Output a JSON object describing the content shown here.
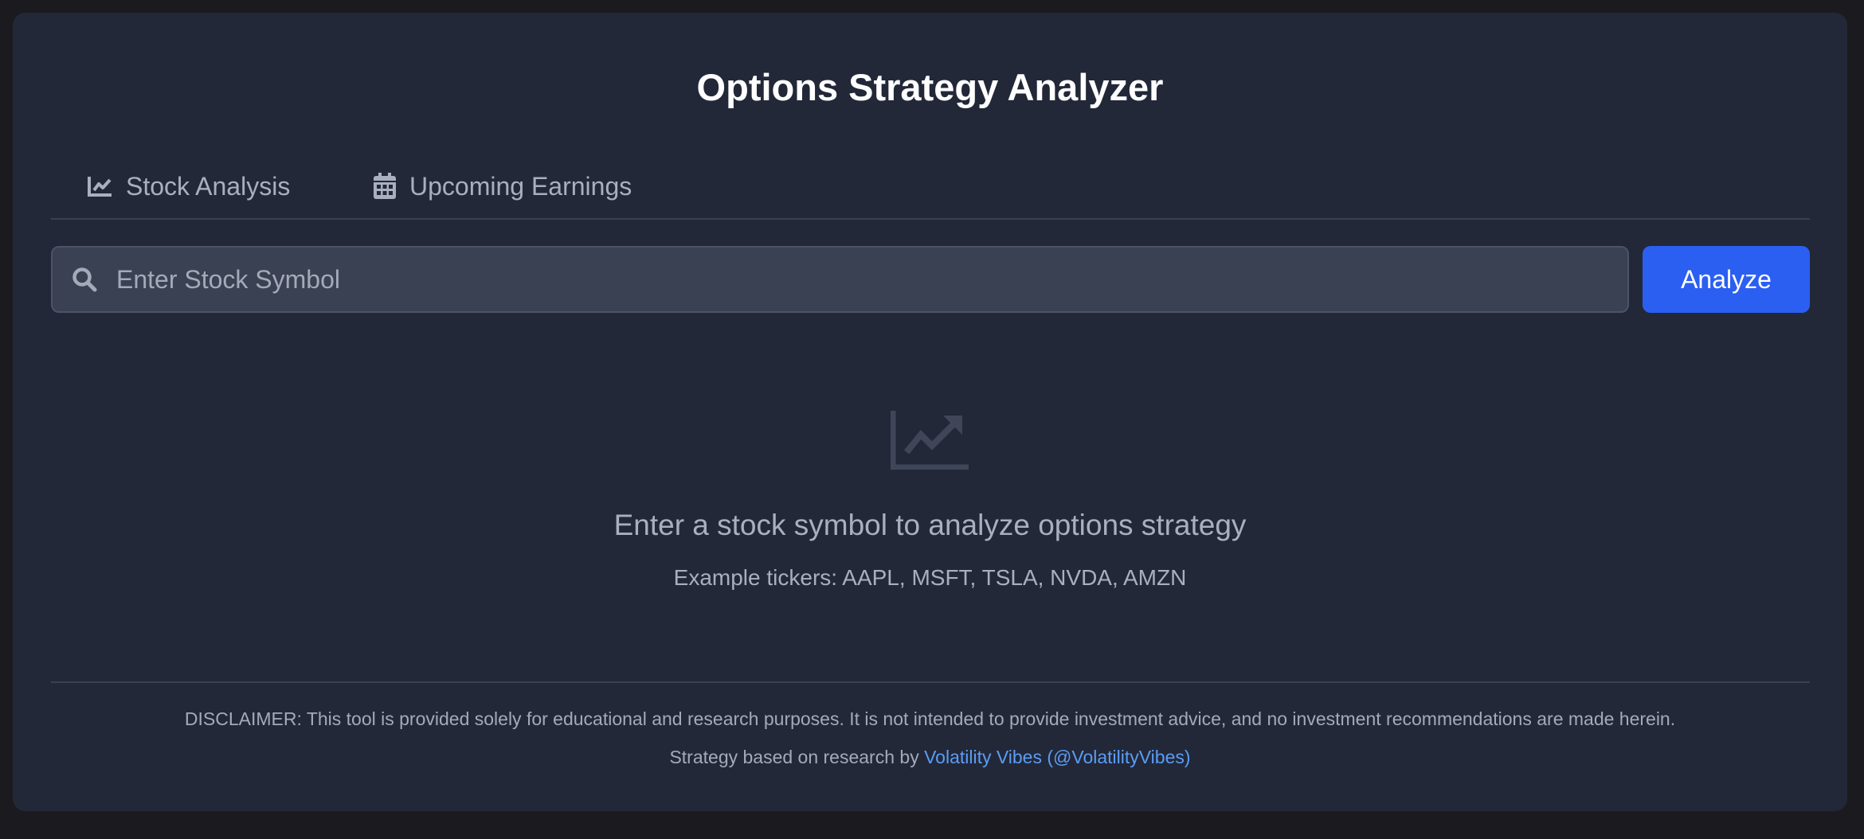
{
  "app": {
    "title": "Options Strategy Analyzer"
  },
  "tabs": [
    {
      "label": "Stock Analysis",
      "icon": "chart-line-icon",
      "active": true
    },
    {
      "label": "Upcoming Earnings",
      "icon": "calendar-icon",
      "active": false
    }
  ],
  "search": {
    "placeholder": "Enter Stock Symbol",
    "value": "",
    "icon": "search-icon",
    "button_label": "Analyze"
  },
  "empty_state": {
    "icon": "chart-line-icon",
    "heading": "Enter a stock symbol to analyze options strategy",
    "subtext": "Example tickers: AAPL, MSFT, TSLA, NVDA, AMZN"
  },
  "footer": {
    "disclaimer": "DISCLAIMER: This tool is provided solely for educational and research purposes. It is not intended to provide investment advice, and no investment recommendations are made herein.",
    "credit_prefix": "Strategy based on research by",
    "credit_link": "Volatility Vibes (@VolatilityVibes)"
  },
  "colors": {
    "page_background": "#1b1b1f",
    "card_background": "#222838",
    "accent": "#2b5ff2",
    "link": "#5b9cf5",
    "muted_text": "#a8b0bf"
  }
}
